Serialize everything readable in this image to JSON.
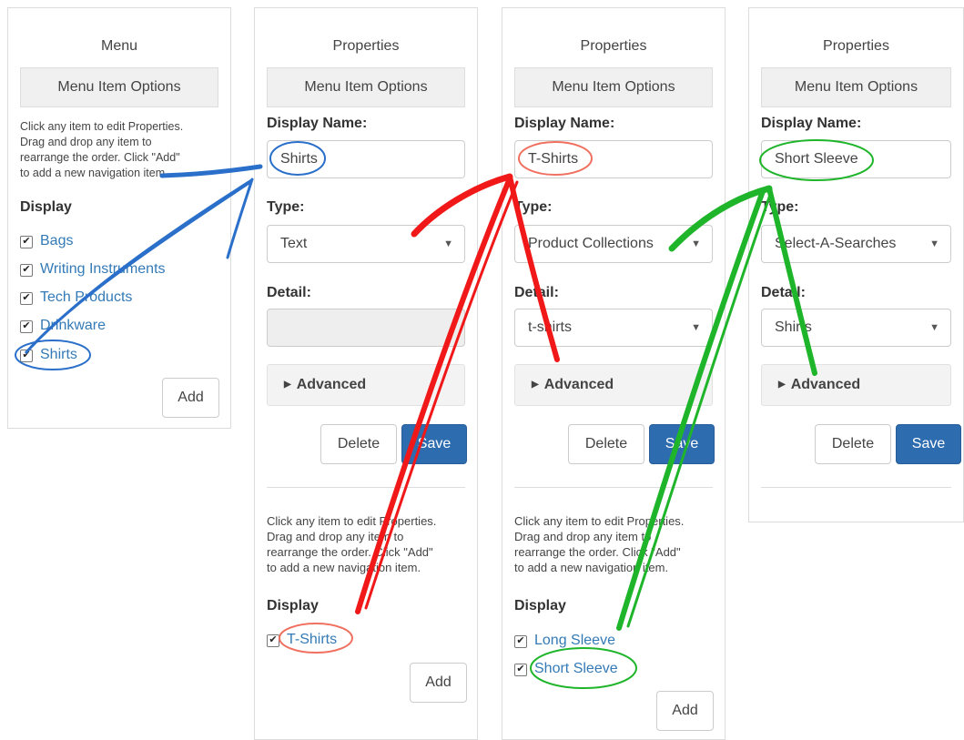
{
  "panels": [
    {
      "title": "Menu",
      "options_button": "Menu Item Options",
      "help_lines": [
        "Click any item to edit Properties.",
        "Drag and drop any item to",
        "rearrange the order. Click \"Add\"",
        "to add a new navigation item."
      ],
      "display_label": "Display",
      "items": [
        "Bags",
        "Writing Instruments",
        "Tech Products",
        "Drinkware",
        "Shirts"
      ],
      "add_label": "Add"
    },
    {
      "title": "Properties",
      "options_button": "Menu Item Options",
      "display_name_label": "Display Name:",
      "display_name_value": "Shirts",
      "type_label": "Type:",
      "type_value": "Text",
      "detail_label": "Detail:",
      "detail_value": "",
      "advanced_label": "Advanced",
      "delete_label": "Delete",
      "save_label": "Save",
      "help_lines": [
        "Click any item to edit Properties.",
        "Drag and drop any item to",
        "rearrange the order. Click \"Add\"",
        "to add a new navigation item."
      ],
      "display_label": "Display",
      "items": [
        "T-Shirts"
      ],
      "add_label": "Add"
    },
    {
      "title": "Properties",
      "options_button": "Menu Item Options",
      "display_name_label": "Display Name:",
      "display_name_value": "T-Shirts",
      "type_label": "Type:",
      "type_value": "Product Collections",
      "detail_label": "Detail:",
      "detail_value": "t-shirts",
      "advanced_label": "Advanced",
      "delete_label": "Delete",
      "save_label": "Save",
      "help_lines": [
        "Click any item to edit Properties.",
        "Drag and drop any item to",
        "rearrange the order. Click \"Add\"",
        "to add a new navigation item."
      ],
      "display_label": "Display",
      "items": [
        "Long Sleeve",
        "Short Sleeve"
      ],
      "add_label": "Add"
    },
    {
      "title": "Properties",
      "options_button": "Menu Item Options",
      "display_name_label": "Display Name:",
      "display_name_value": "Short Sleeve",
      "type_label": "Type:",
      "type_value": "Select-A-Searches",
      "detail_label": "Detail:",
      "detail_value": "Shirts",
      "advanced_label": "Advanced",
      "delete_label": "Delete",
      "save_label": "Save"
    }
  ],
  "icons": {
    "checkbox": "checkmark-icon",
    "caret": "caret-down-icon",
    "advanced": "triangle-right-icon"
  },
  "colors": {
    "link": "#337ab7",
    "primary": "#2e6cb0",
    "annotation_blue": "#2a6fc9",
    "annotation_red": "#f01818",
    "annotation_green": "#1fb52a"
  }
}
